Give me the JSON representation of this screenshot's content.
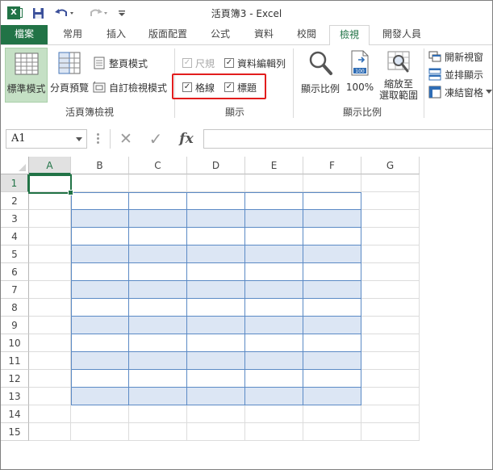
{
  "app": {
    "title": "活頁簿3 - Excel",
    "logo_text": "X",
    "accent_color": "#217346"
  },
  "quick_access": {
    "items": [
      {
        "name": "save-icon"
      },
      {
        "name": "undo-icon"
      },
      {
        "name": "redo-icon"
      },
      {
        "name": "customize-qat-icon"
      }
    ]
  },
  "tabs": [
    {
      "label": "檔案",
      "state": "file"
    },
    {
      "label": "常用"
    },
    {
      "label": "插入"
    },
    {
      "label": "版面配置"
    },
    {
      "label": "公式"
    },
    {
      "label": "資料"
    },
    {
      "label": "校閱"
    },
    {
      "label": "檢視",
      "state": "active"
    },
    {
      "label": "開發人員"
    }
  ],
  "ribbon": {
    "workbook_views": {
      "label": "活頁簿檢視",
      "normal": "標準模式",
      "page_break_preview": "分頁預覽",
      "page_layout": "整頁模式",
      "custom_views": "自訂檢視模式"
    },
    "show": {
      "label": "顯示",
      "ruler": "尺規",
      "formula_bar": "資料編輯列",
      "gridlines": "格線",
      "headings": "標題",
      "ruler_checked": true,
      "formula_bar_checked": true,
      "gridlines_checked": true,
      "headings_checked": true,
      "ruler_enabled": false
    },
    "zoom": {
      "label": "顯示比例",
      "zoom": "顯示比例",
      "hundred": "100%",
      "zoom_to_selection_line1": "縮放至",
      "zoom_to_selection_line2": "選取範圍",
      "hundred_icon_text": "100"
    },
    "window": {
      "new_window": "開新視窗",
      "arrange_all": "並排顯示",
      "freeze_panes": "凍結窗格"
    }
  },
  "formula_bar": {
    "name_box": "A1",
    "fx": "fx",
    "cancel_glyph": "✕",
    "enter_glyph": "✓",
    "value": ""
  },
  "sheet": {
    "columns": [
      "A",
      "B",
      "C",
      "D",
      "E",
      "F",
      "G"
    ],
    "rows": [
      "1",
      "2",
      "3",
      "4",
      "5",
      "6",
      "7",
      "8",
      "9",
      "10",
      "11",
      "12",
      "13",
      "14",
      "15"
    ],
    "active_cell": "A1",
    "table_range": "B2:F13",
    "band_color": "#dce6f4",
    "table_border_color": "#5b8ac5"
  }
}
